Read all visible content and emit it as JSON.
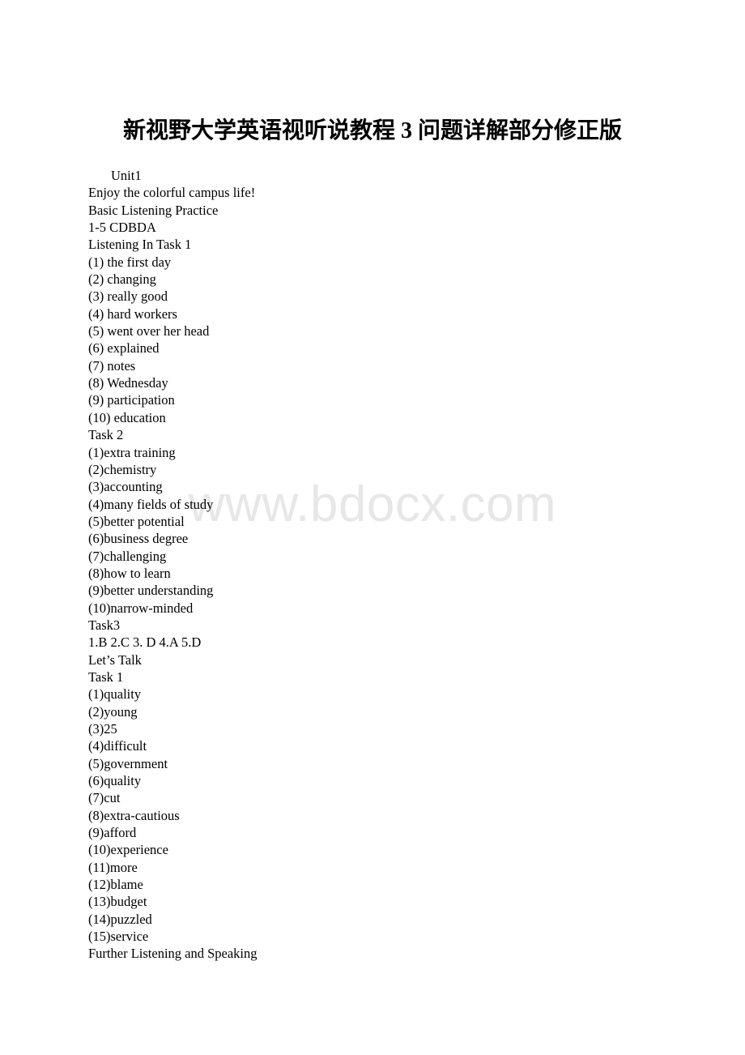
{
  "document": {
    "title": "新视野大学英语视听说教程 3 问题详解部分修正版",
    "watermark": "www.bdocx.com",
    "lines": [
      {
        "text": "Unit1",
        "indent": true
      },
      {
        "text": "Enjoy the colorful campus life!",
        "indent": false
      },
      {
        "text": "Basic Listening Practice",
        "indent": false
      },
      {
        "text": "1-5 CDBDA",
        "indent": false
      },
      {
        "text": "Listening In Task 1",
        "indent": false
      },
      {
        "text": "(1) the first day",
        "indent": false
      },
      {
        "text": "(2) changing",
        "indent": false
      },
      {
        "text": "(3) really good",
        "indent": false
      },
      {
        "text": "(4) hard workers",
        "indent": false
      },
      {
        "text": "(5) went over her head",
        "indent": false
      },
      {
        "text": "(6) explained",
        "indent": false
      },
      {
        "text": "(7) notes",
        "indent": false
      },
      {
        "text": "(8) Wednesday",
        "indent": false
      },
      {
        "text": "(9) participation",
        "indent": false
      },
      {
        "text": "(10) education",
        "indent": false
      },
      {
        "text": "Task 2",
        "indent": false
      },
      {
        "text": "(1)extra training",
        "indent": false
      },
      {
        "text": "(2)chemistry",
        "indent": false
      },
      {
        "text": "(3)accounting",
        "indent": false
      },
      {
        "text": "(4)many fields of study",
        "indent": false
      },
      {
        "text": "(5)better potential",
        "indent": false
      },
      {
        "text": "(6)business degree",
        "indent": false
      },
      {
        "text": "(7)challenging",
        "indent": false
      },
      {
        "text": "(8)how to learn",
        "indent": false
      },
      {
        "text": "(9)better understanding",
        "indent": false
      },
      {
        "text": "(10)narrow-minded",
        "indent": false
      },
      {
        "text": "Task3",
        "indent": false
      },
      {
        "text": "1.B 2.C 3. D 4.A 5.D",
        "indent": false
      },
      {
        "text": "Let’s Talk",
        "indent": false
      },
      {
        "text": "Task 1",
        "indent": false
      },
      {
        "text": "(1)quality",
        "indent": false
      },
      {
        "text": "(2)young",
        "indent": false
      },
      {
        "text": "(3)25",
        "indent": false
      },
      {
        "text": "(4)difficult",
        "indent": false
      },
      {
        "text": "(5)government",
        "indent": false
      },
      {
        "text": "(6)quality",
        "indent": false
      },
      {
        "text": "(7)cut",
        "indent": false
      },
      {
        "text": "(8)extra-cautious",
        "indent": false
      },
      {
        "text": "(9)afford",
        "indent": false
      },
      {
        "text": "(10)experience",
        "indent": false
      },
      {
        "text": "(11)more",
        "indent": false
      },
      {
        "text": "(12)blame",
        "indent": false
      },
      {
        "text": "(13)budget",
        "indent": false
      },
      {
        "text": "(14)puzzled",
        "indent": false
      },
      {
        "text": "(15)service",
        "indent": false
      },
      {
        "text": "Further Listening and Speaking",
        "indent": false
      }
    ]
  }
}
